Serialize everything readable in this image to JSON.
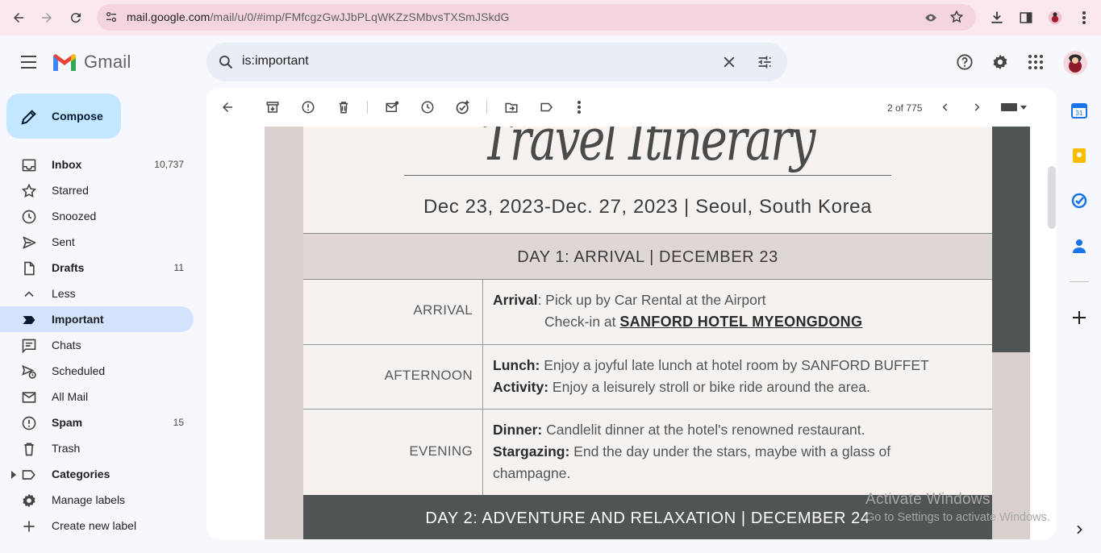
{
  "browser": {
    "url_host": "mail.google.com",
    "url_path": "/mail/u/0/#imp/FMfcgzGwJJbPLqWKZzSMbvsTXSmJSkdG"
  },
  "app": {
    "name": "Gmail"
  },
  "search": {
    "query": "is:important"
  },
  "compose": {
    "label": "Compose"
  },
  "sidebar": {
    "items": [
      {
        "label": "Inbox",
        "count": "10,737",
        "bold": true
      },
      {
        "label": "Starred",
        "count": ""
      },
      {
        "label": "Snoozed",
        "count": ""
      },
      {
        "label": "Sent",
        "count": ""
      },
      {
        "label": "Drafts",
        "count": "11",
        "bold": true
      },
      {
        "label": "Less",
        "count": ""
      },
      {
        "label": "Important",
        "count": "",
        "active": true
      },
      {
        "label": "Chats",
        "count": ""
      },
      {
        "label": "Scheduled",
        "count": ""
      },
      {
        "label": "All Mail",
        "count": ""
      },
      {
        "label": "Spam",
        "count": "15",
        "bold": true
      },
      {
        "label": "Trash",
        "count": ""
      },
      {
        "label": "Categories",
        "count": "",
        "bold": true
      },
      {
        "label": "Manage labels",
        "count": ""
      },
      {
        "label": "Create new label",
        "count": ""
      }
    ]
  },
  "toolbar": {
    "pager": "2 of 775"
  },
  "itinerary": {
    "title": "Travel Itinerary",
    "dates": "Dec 23, 2023-Dec. 27, 2023 |  Seoul, South Korea",
    "day1": "DAY 1: ARRIVAL | DECEMBER 23",
    "rows": [
      {
        "time": "ARRIVAL",
        "l1_head": "Arrival",
        "l1_text": ": Pick up by Car Rental at the Airport",
        "l2_text": "Check-in at ",
        "l2_hotel": "SANFORD HOTEL MYEONGDONG"
      },
      {
        "time": "AFTERNOON",
        "l1_head": "Lunch:",
        "l1_text": " Enjoy a joyful late lunch at hotel room by SANFORD BUFFET",
        "l2_head": "Activity:",
        "l2_text": " Enjoy a leisurely stroll or bike ride around the area."
      },
      {
        "time": "EVENING",
        "l1_head": "Dinner:",
        "l1_text": " Candlelit dinner at the hotel's renowned restaurant.",
        "l2_head": "Stargazing:",
        "l2_text": " End the day under the stars, maybe with a glass of",
        "l3_text": "champagne."
      }
    ],
    "day2": "DAY 2: ADVENTURE AND RELAXATION | DECEMBER 24"
  },
  "watermark": {
    "line1": "Activate Windows",
    "line2": "Go to Settings to activate Windows."
  },
  "colors": {
    "accent": "#0b57d0",
    "compose_bg": "#c2e7ff",
    "active_nav": "#d3e3fd",
    "chrome_bg": "#fbe8ee"
  }
}
